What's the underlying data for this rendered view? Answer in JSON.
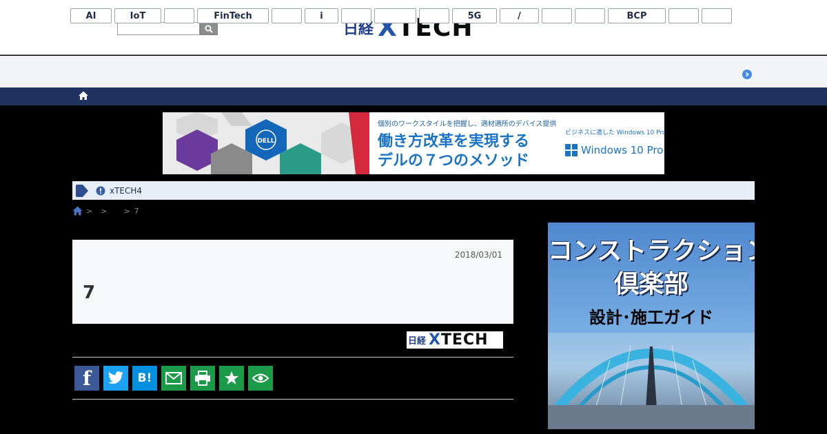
{
  "header": {
    "search_placeholder": "",
    "logo_jp": "日経",
    "logo_x": "X",
    "logo_rest": "TECH"
  },
  "tags": [
    "AI",
    "IoT",
    "",
    "FinTech",
    "",
    "i",
    "",
    "",
    "",
    "5G",
    "/",
    "",
    "",
    "BCP",
    "",
    ""
  ],
  "ad": {
    "line1": "個別のワークスタイルを把握し、適材適所のデバイス提供",
    "line2": "働き方改革を実現する",
    "line3": "デルの７つのメソッド",
    "side_text": "ビジネスに適した Windows 10 Pro。",
    "side_logo": "Windows 10 Pro",
    "brand": "DELL"
  },
  "notice": {
    "text": "xTECH4"
  },
  "breadcrumb": {
    "sep1": ">",
    "sep2": ">",
    "sep3": ">",
    "last": "7"
  },
  "article": {
    "date": "2018/03/01",
    "title": "7"
  },
  "source_logo": {
    "jp": "日経",
    "x": "X",
    "rest": "TECH"
  },
  "share": {
    "facebook": "f",
    "hatena": "B!"
  },
  "side_ad": {
    "title1": "コンストラクション",
    "title2": "倶楽部",
    "sub": "設計･施工ガイド"
  },
  "colors": {
    "navy": "#1f3260",
    "facebook": "#3b5998",
    "twitter": "#1da1f2",
    "hatena": "#008fde",
    "green": "#1b9a4a"
  }
}
